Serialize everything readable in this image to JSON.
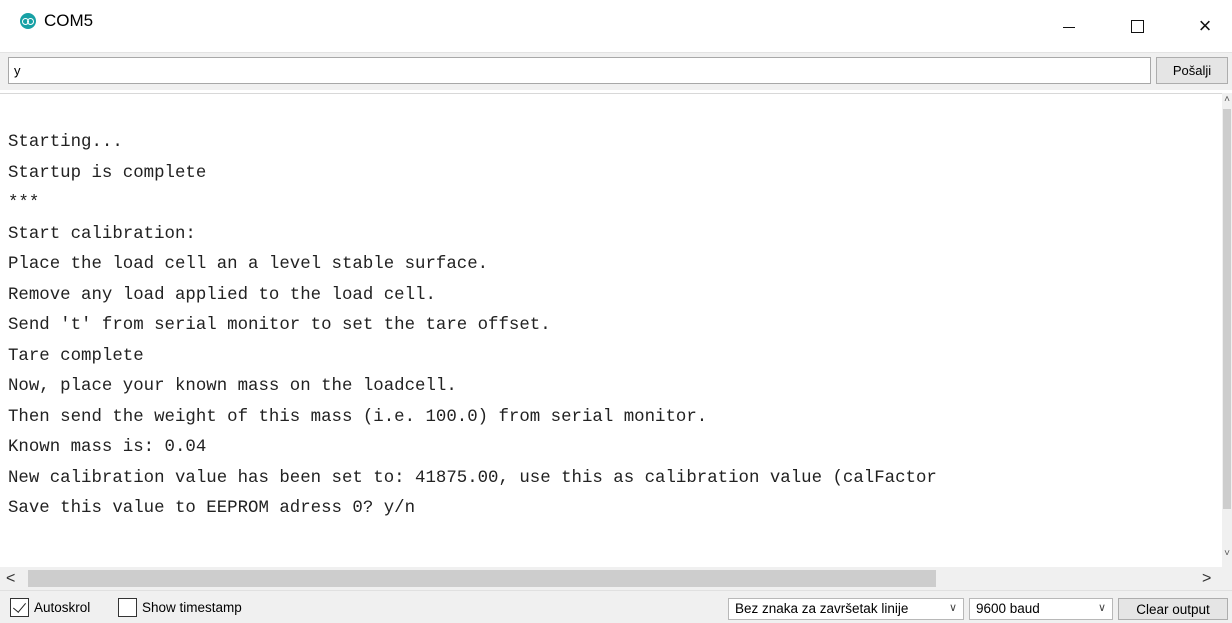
{
  "window": {
    "title": "COM5",
    "app_icon": "arduino-icon",
    "controls": {
      "minimize_icon": "minimize-icon",
      "maximize_icon": "maximize-icon",
      "close_icon": "close-icon",
      "close_glyph": "×"
    }
  },
  "send": {
    "input_value": "y",
    "button_label": "Pošalji"
  },
  "output": {
    "lines": [
      "Starting...",
      "Startup is complete",
      "***",
      "Start calibration:",
      "Place the load cell an a level stable surface.",
      "Remove any load applied to the load cell.",
      "Send 't' from serial monitor to set the tare offset.",
      "Tare complete",
      "Now, place your known mass on the loadcell.",
      "Then send the weight of this mass (i.e. 100.0) from serial monitor.",
      "Known mass is: 0.04",
      "New calibration value has been set to: 41875.00, use this as calibration value (calFactor",
      "Save this value to EEPROM adress 0? y/n"
    ]
  },
  "scrollbars": {
    "up_glyph": "˄",
    "down_glyph": "˅",
    "left_glyph": "<",
    "right_glyph": ">"
  },
  "footer": {
    "autoscroll_label": "Autoskrol",
    "autoscroll_checked": true,
    "timestamp_label": "Show timestamp",
    "timestamp_checked": false,
    "line_ending": "Bez znaka za završetak linije",
    "baud_rate": "9600 baud",
    "dropdown_glyph": "∨",
    "clear_label": "Clear output"
  }
}
